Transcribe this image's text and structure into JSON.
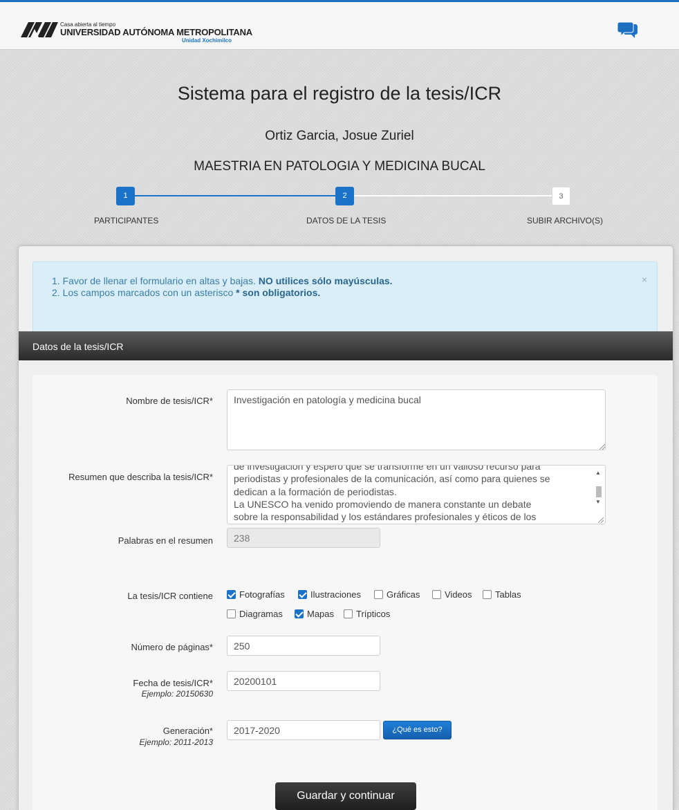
{
  "header": {
    "logo": {
      "tagline": "Casa abierta al tiempo",
      "university": "UNIVERSIDAD AUTÓNOMA METROPOLITANA",
      "unit": "Unidad Xochimilco"
    },
    "chat_icon": "chat-bubbles-icon"
  },
  "page": {
    "title": "Sistema para el registro de la tesis/ICR",
    "student_name": "Ortiz Garcia, Josue Zuriel",
    "program": "MAESTRIA EN PATOLOGIA Y MEDICINA BUCAL"
  },
  "stepper": {
    "steps": [
      {
        "number": "1",
        "label": "PARTICIPANTES",
        "state": "done"
      },
      {
        "number": "2",
        "label": "DATOS DE LA TESIS",
        "state": "current"
      },
      {
        "number": "3",
        "label": "SUBIR ARCHIVO(S)",
        "state": "pending"
      }
    ]
  },
  "notice": {
    "line1_prefix": "1. Favor de llenar el formulario en altas y bajas. ",
    "line1_bold": "NO utilices sólo mayúsculas.",
    "line2_prefix": "2. Los campos marcados con un asterisco ",
    "line2_bold": "* son obligatorios.",
    "close": "×"
  },
  "section": {
    "title": "Datos de la tesis/ICR"
  },
  "form": {
    "thesis_name": {
      "label": "Nombre de tesis/ICR*",
      "value": "Investigación en patología y medicina bucal"
    },
    "summary": {
      "label": "Resumen que describa la tesis/ICR*",
      "visible_lines": [
        "de investigación y espero que se transforme en un valioso recurso para",
        "periodistas y profesionales de la comunicación, así como para quienes se",
        "dedican a la formación de periodistas.",
        "La UNESCO ha venido promoviendo de manera constante un debate",
        "sobre la responsabilidad y los estándares profesionales y éticos de los"
      ]
    },
    "word_count": {
      "label": "Palabras en el resumen",
      "value": "238"
    },
    "contains": {
      "label": "La tesis/ICR contiene",
      "options": [
        {
          "label": "Fotografías",
          "checked": true
        },
        {
          "label": "Ilustraciones",
          "checked": true
        },
        {
          "label": "Gráficas",
          "checked": false
        },
        {
          "label": "Videos",
          "checked": false
        },
        {
          "label": "Tablas",
          "checked": false
        },
        {
          "label": "Diagramas",
          "checked": false
        },
        {
          "label": "Mapas",
          "checked": true
        },
        {
          "label": "Trípticos",
          "checked": false
        }
      ]
    },
    "pages": {
      "label": "Número de páginas*",
      "value": "250"
    },
    "date": {
      "label": "Fecha de tesis/ICR*",
      "hint": "Ejemplo: 20150630",
      "value": "20200101"
    },
    "generation": {
      "label": "Generación*",
      "hint": "Ejemplo: 2011-2013",
      "value": "2017-2020",
      "info_button": "¿Qué es esto?"
    },
    "submit_label": "Guardar y continuar"
  },
  "colors": {
    "accent": "#1a73c9",
    "notice_bg": "#d9eef8",
    "notice_text": "#3a7ea8",
    "section_header": "#333333"
  }
}
